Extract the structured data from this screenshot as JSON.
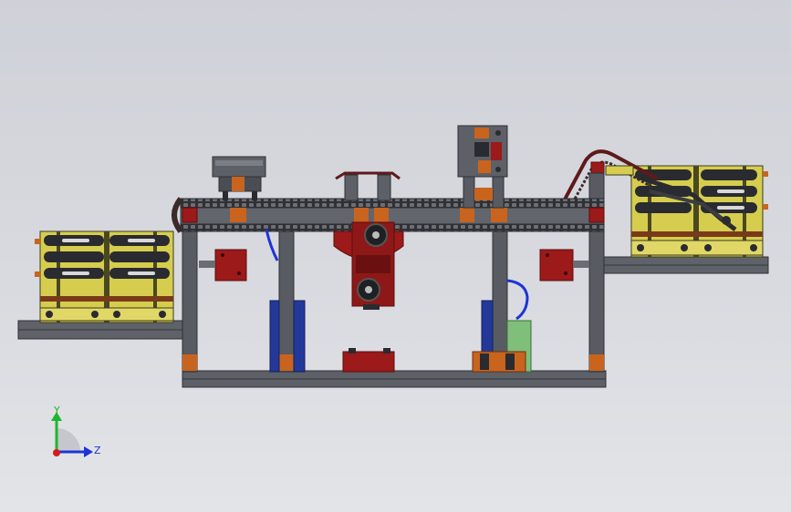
{
  "colors": {
    "frame": "#55585e",
    "frame_dark": "#2e3035",
    "frame_light": "#8a8d93",
    "orange": "#c8641e",
    "red": "#9c1a1a",
    "red_dark": "#5e0c0c",
    "yellow": "#d8cf52",
    "blue": "#23399a",
    "green": "#7fbf7a",
    "chain": "#3a2a2a"
  },
  "triad": {
    "y_label": "Y",
    "z_label": "Z",
    "y_color": "#1fb52c",
    "z_color": "#1d34d6",
    "x_color": "#d41c1c"
  }
}
